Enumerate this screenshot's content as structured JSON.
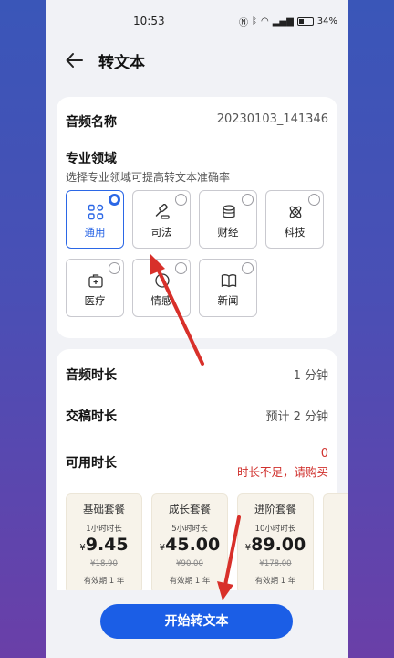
{
  "status": {
    "time": "10:53",
    "battery": "34%"
  },
  "header": {
    "title": "转文本"
  },
  "audio": {
    "name_label": "音频名称",
    "name_value": "20230103_141346"
  },
  "domain": {
    "title": "专业领域",
    "hint": "选择专业领域可提高转文本准确率",
    "items": [
      {
        "label": "通用",
        "icon": "grid-icon",
        "selected": true
      },
      {
        "label": "司法",
        "icon": "gavel-icon",
        "selected": false
      },
      {
        "label": "财经",
        "icon": "coins-icon",
        "selected": false
      },
      {
        "label": "科技",
        "icon": "atom-icon",
        "selected": false
      },
      {
        "label": "医疗",
        "icon": "medkit-icon",
        "selected": false
      },
      {
        "label": "情感",
        "icon": "heart-icon",
        "selected": false
      },
      {
        "label": "新闻",
        "icon": "book-icon",
        "selected": false
      }
    ]
  },
  "duration": {
    "audio_label": "音频时长",
    "audio_value": "1 分钟",
    "transcribe_label": "交稿时长",
    "transcribe_value": "预计 2 分钟",
    "available_label": "可用时长",
    "available_value": "0",
    "available_warning": "时长不足，请购买"
  },
  "packages": [
    {
      "name": "基础套餐",
      "hours": "1小时时长",
      "currency": "¥",
      "price": "9.45",
      "original": "¥18.90",
      "validity": "有效期 1 年"
    },
    {
      "name": "成长套餐",
      "hours": "5小时时长",
      "currency": "¥",
      "price": "45.00",
      "original": "¥90.00",
      "validity": "有效期 1 年"
    },
    {
      "name": "进阶套餐",
      "hours": "10小时时长",
      "currency": "¥",
      "price": "89.00",
      "original": "¥178.00",
      "validity": "有效期 1 年"
    }
  ],
  "action": {
    "start_label": "开始转文本"
  },
  "colors": {
    "accent": "#1b5ee6",
    "warning": "#d0312d",
    "annotation_arrow": "#d8302a"
  }
}
